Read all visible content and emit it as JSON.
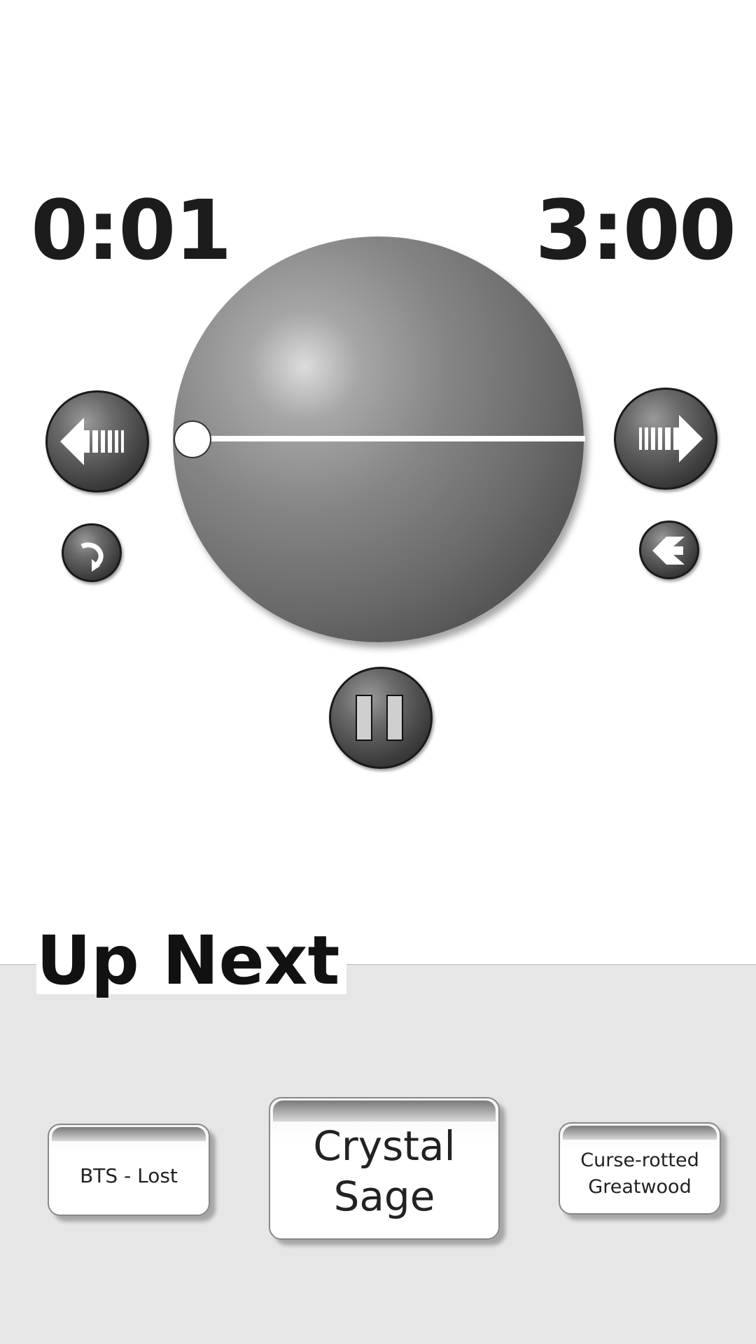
{
  "player": {
    "time_elapsed": "0:01",
    "time_total": "3:00",
    "progress_fraction": 0.0056,
    "state": "playing"
  },
  "controls": {
    "prev_icon": "rewind-arrow-icon",
    "next_icon": "forward-arrow-icon",
    "replay_icon": "replay-icon",
    "shuffle_icon": "shuffle-icon",
    "pause_icon": "pause-icon"
  },
  "up_next": {
    "title": "Up Next",
    "items": [
      {
        "label": "BTS - Lost"
      },
      {
        "label": "Crystal\nSage"
      },
      {
        "label": "Curse-rotted\nGreatwood"
      }
    ]
  },
  "colors": {
    "background": "#ffffff",
    "panel": "#e6e6e6",
    "text": "#1c1c1c"
  }
}
